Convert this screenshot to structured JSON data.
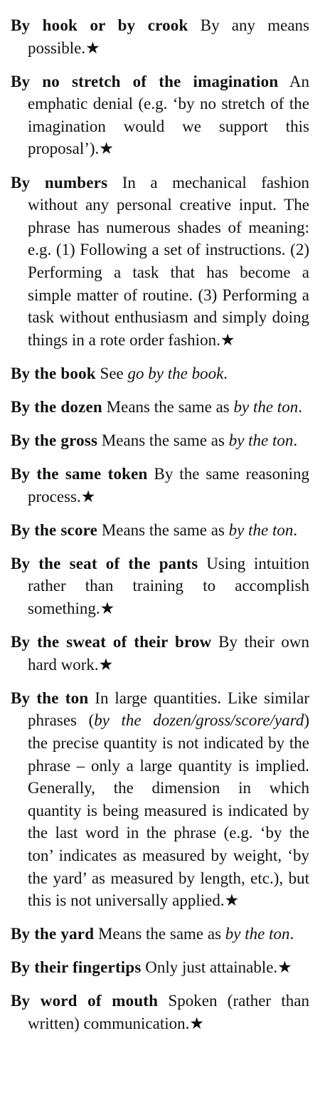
{
  "entries": [
    {
      "headword": "By hook or by crook",
      "parts": [
        {
          "text": " By any means possible.★"
        }
      ]
    },
    {
      "headword": "By no stretch of the imagination",
      "parts": [
        {
          "text": " An emphatic denial (e.g. ‘by no stretch of the imagination would we support this proposal’).★"
        }
      ]
    },
    {
      "headword": "By numbers",
      "parts": [
        {
          "text": " In a mechanical fashion without any personal creative input. The phrase has numerous shades of meaning: e.g. (1) Following a set of instructions. (2) Performing a task that has become a simple matter of routine. (3) Performing a task without enthusiasm and simply doing things in a rote order fashion.★"
        }
      ]
    },
    {
      "headword": "By the book",
      "parts": [
        {
          "text": " See "
        },
        {
          "text": "go by the book",
          "italic": true
        },
        {
          "text": "."
        }
      ]
    },
    {
      "headword": "By the dozen",
      "parts": [
        {
          "text": " Means the same as "
        },
        {
          "text": "by the ton",
          "italic": true
        },
        {
          "text": "."
        }
      ]
    },
    {
      "headword": "By the gross",
      "parts": [
        {
          "text": " Means the same as "
        },
        {
          "text": "by the ton",
          "italic": true
        },
        {
          "text": "."
        }
      ]
    },
    {
      "headword": "By the same token",
      "parts": [
        {
          "text": " By the same reasoning process.★"
        }
      ]
    },
    {
      "headword": "By the score",
      "parts": [
        {
          "text": " Means the same as "
        },
        {
          "text": "by the ton",
          "italic": true
        },
        {
          "text": "."
        }
      ]
    },
    {
      "headword": "By the seat of the pants",
      "parts": [
        {
          "text": " Using intuition rather than training to accomplish something.★"
        }
      ]
    },
    {
      "headword": "By the sweat of their brow",
      "parts": [
        {
          "text": " By their own hard work.★"
        }
      ]
    },
    {
      "headword": "By the ton",
      "parts": [
        {
          "text": " In large quantities. Like similar phrases ("
        },
        {
          "text": "by the dozen/gross/score/yard",
          "italic": true
        },
        {
          "text": ") the precise quantity is not indicated by the phrase – only a large quantity is implied. Generally, the dimension in which quantity is being measured is indicated by the last word in the phrase (e.g. ‘by the ton’ indicates as measured by weight, ‘by the yard’ as measured by length, etc.), but this is not universally applied.★"
        }
      ]
    },
    {
      "headword": "By the yard",
      "parts": [
        {
          "text": " Means the same as "
        },
        {
          "text": "by the ton",
          "italic": true
        },
        {
          "text": "."
        }
      ]
    },
    {
      "headword": "By their fingertips",
      "parts": [
        {
          "text": " Only just attainable.★"
        }
      ]
    },
    {
      "headword": "By word of mouth",
      "parts": [
        {
          "text": " Spoken (rather than written) communication.★"
        }
      ]
    }
  ]
}
